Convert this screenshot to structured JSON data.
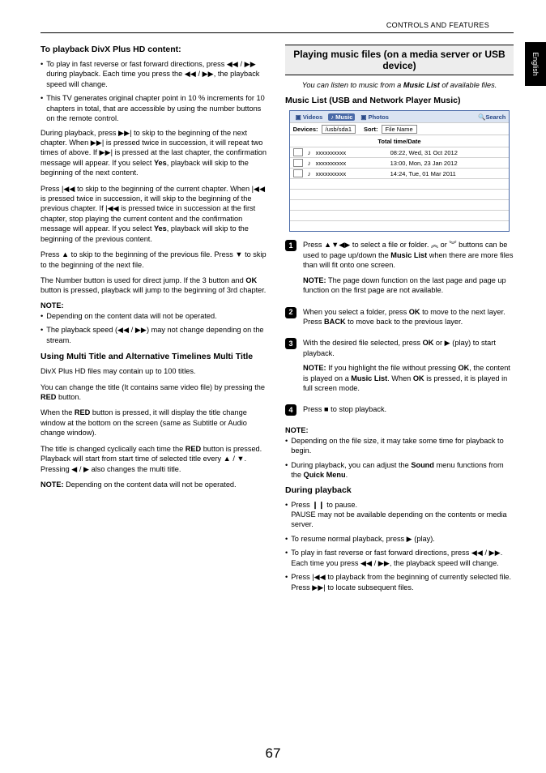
{
  "header": "CONTROLS AND FEATURES",
  "side_tab": "English",
  "page_number": "67",
  "left": {
    "h1": "To playback DivX Plus HD content:",
    "b1": "To play in fast reverse or fast forward directions, press ◀◀ / ▶▶ during playback. Each time you press the ◀◀ / ▶▶, the playback speed will change.",
    "b2": "This TV generates original chapter point in 10 % increments for 10 chapters in total, that are accessible by using the number buttons on the remote control.",
    "p1a": "During playback, press ▶▶| to skip to the beginning of the next chapter. When ▶▶| is pressed twice in succession, it will repeat two times of above. If ▶▶| is pressed at the last chapter, the confirmation message will appear. If you select ",
    "p1b": ", playback will skip to the beginning of the next content.",
    "p2a": "Press |◀◀ to skip to the beginning of the current chapter. When |◀◀ is pressed twice in succession, it will skip to the beginning of the previous chapter. If |◀◀ is pressed twice in succession at the first chapter, stop playing the current content and the confirmation message will appear. If you select ",
    "p2b": ", playback will skip to the beginning of the previous content.",
    "p3": "Press ▲ to skip to the beginning of the previous file. Press ▼ to skip to the beginning of the next file.",
    "p4a": "The Number button is used for direct jump. If the 3 button and ",
    "p4b": " button is pressed, playback will jump to the beginning of 3rd chapter.",
    "note1": "NOTE:",
    "nb1": "Depending on the content data will not be operated.",
    "nb2": "The playback speed (◀◀ / ▶▶) may not change depending on the stream.",
    "h2": "Using Multi Title and Alternative Timelines Multi Title",
    "p5": "DivX Plus HD files may contain up to 100 titles.",
    "p6a": "You can change the title (It contains same video file) by pressing the ",
    "p6b": " button.",
    "p7a": "When the ",
    "p7b": " button is pressed, it will display the title change window at the bottom on the screen (same as Subtitle or Audio change window).",
    "p8a": "The title is changed cyclically each time the ",
    "p8b": " button is pressed. Playback will start from start time of selected title every ▲ / ▼.",
    "p8c": "Pressing ◀ / ▶ also changes the multi title.",
    "p9a": "NOTE:",
    "p9b": " Depending on the content data will not be operated.",
    "yes": "Yes",
    "ok": "OK",
    "red": "RED"
  },
  "right": {
    "box": "Playing music files (on a media server or USB device)",
    "italic_a": "You can listen to music from a ",
    "italic_b": "Music List",
    "italic_c": " of available files.",
    "h1": "Music List (USB and Network Player Music)",
    "tabs": {
      "videos": "Videos",
      "music": "Music",
      "photos": "Photos",
      "search": "Search"
    },
    "devrow": {
      "devices": "Devices:",
      "devval": "/usb/sda1",
      "sort": "Sort:",
      "sortval": "File Name"
    },
    "total": "Total time/Date",
    "files": [
      {
        "name": "xxxxxxxxxx",
        "time": "08:22, Wed, 31 Oct 2012"
      },
      {
        "name": "xxxxxxxxxx",
        "time": "13:00, Mon, 23 Jan 2012"
      },
      {
        "name": "xxxxxxxxxx",
        "time": "14:24, Tue, 01 Mar 2011"
      }
    ],
    "s1a": "Press ▲▼◀▶ to select a file or folder. ︽ or ︾ buttons can be used to page up/down the ",
    "s1b": "Music List",
    "s1c": " when there are more files than will fit onto one screen.",
    "s1note_a": "NOTE:",
    "s1note_b": " The page down function on the last page and page up function on the first page are not available.",
    "s2a": "When you select a folder, press ",
    "s2b": " to move to the next layer. Press ",
    "s2c": "BACK",
    "s2d": " to move back to the previous layer.",
    "s3a": "With the desired file selected, press ",
    "s3b": " or ▶ (play) to start playback.",
    "s3note_a": "NOTE:",
    "s3note_b": " If you highlight the file without pressing ",
    "s3note_c": ", the content is played on a ",
    "s3note_d": "Music List",
    "s3note_e": ". When ",
    "s3note_f": " is pressed, it is played in full screen mode.",
    "s4": "Press ■ to stop playback.",
    "note2": "NOTE:",
    "nb1": "Depending on the file size, it may take some time for playback to begin.",
    "nb2a": "During playback, you can adjust the ",
    "nb2b": "Sound",
    "nb2c": " menu functions from the ",
    "nb2d": "Quick Menu",
    "nb2e": ".",
    "h2": "During playback",
    "dp1a": "Press ❙❙ to pause.",
    "dp1b": "PAUSE may not be available depending on the contents or media server.",
    "dp2": "To resume normal playback, press ▶ (play).",
    "dp3": "To play in fast reverse or fast forward directions, press ◀◀ / ▶▶. Each time you press ◀◀ / ▶▶, the playback speed will change.",
    "dp4": "Press |◀◀ to playback from the beginning of currently selected file. Press ▶▶| to locate subsequent files.",
    "ok": "OK"
  }
}
